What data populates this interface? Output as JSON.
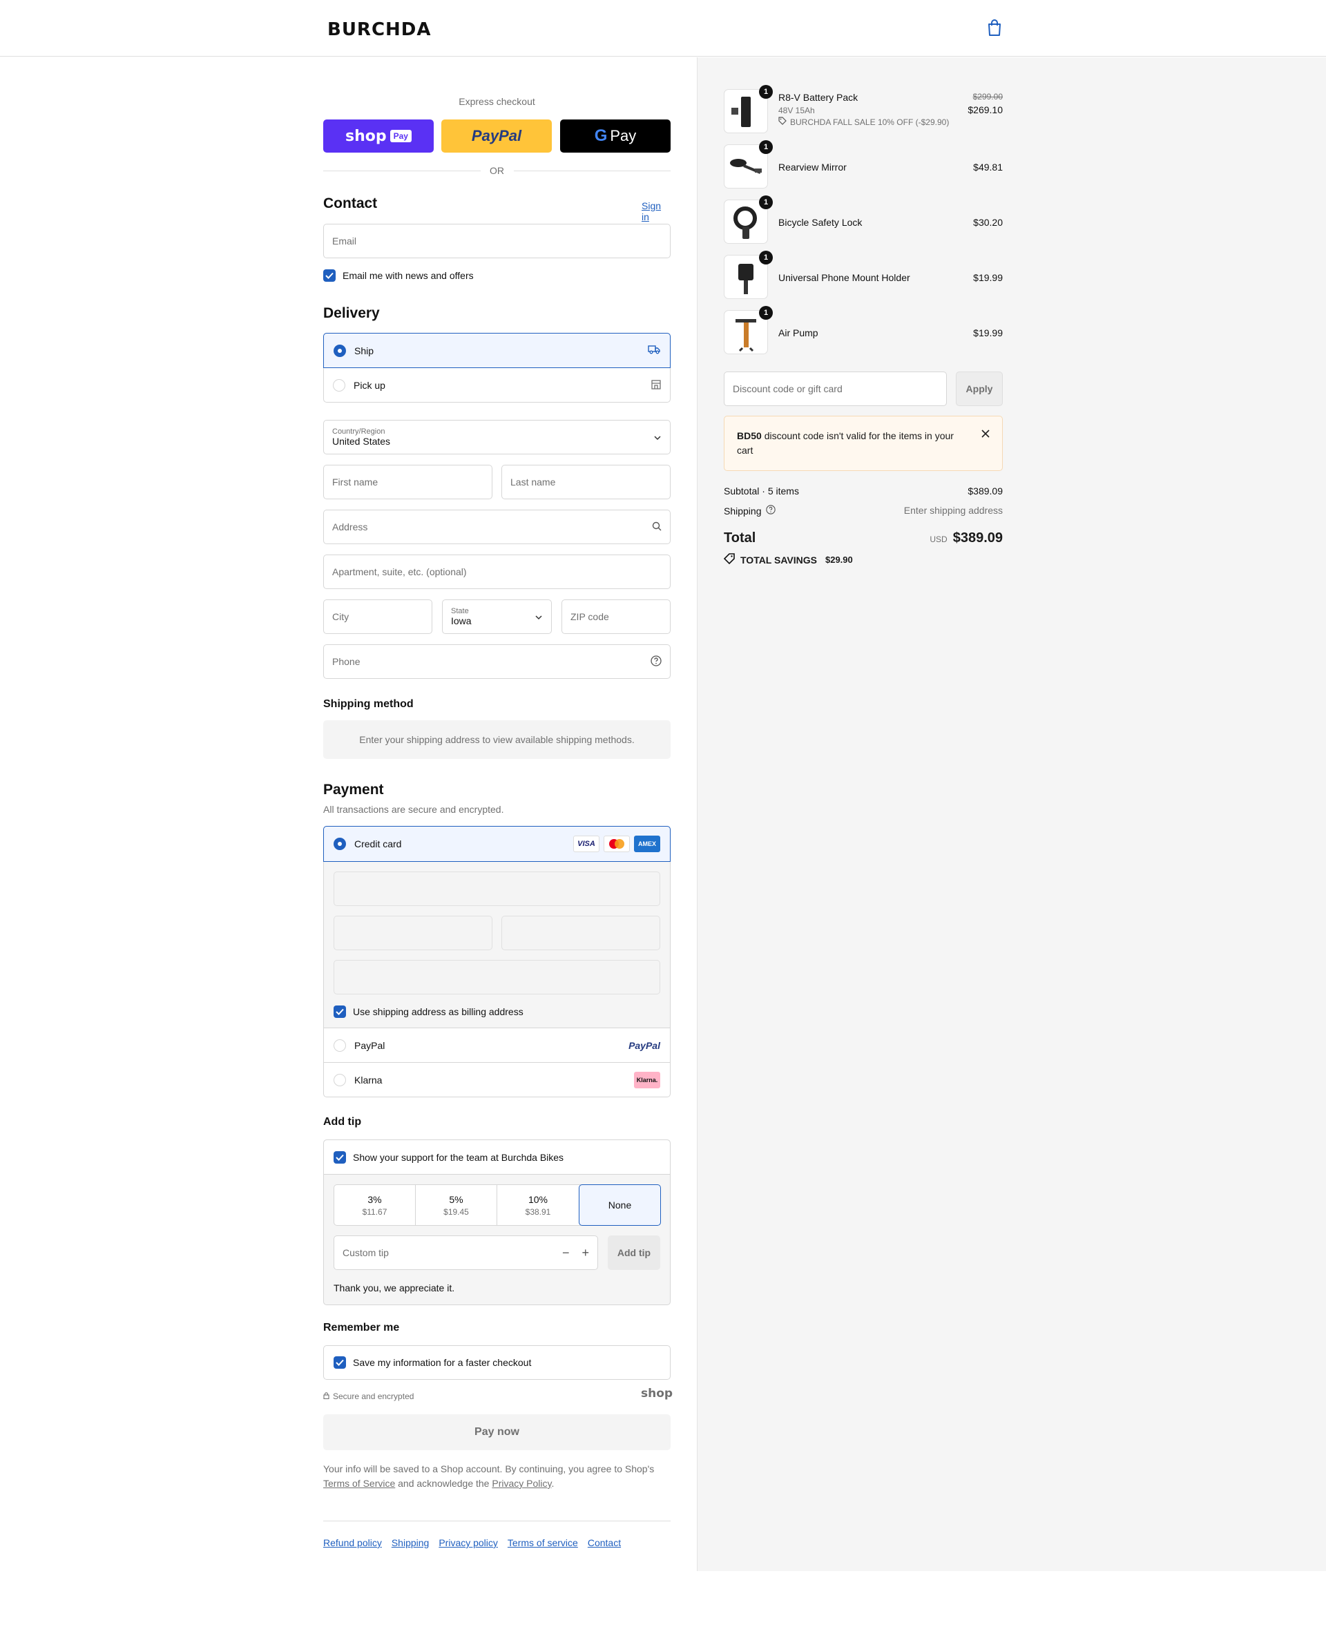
{
  "brand": {
    "logo_text": "BURCHDA"
  },
  "express": {
    "title": "Express checkout",
    "shop_pay_label": "shop",
    "shop_pay_badge": "Pay",
    "paypal_label": "PayPal",
    "gpay_label": "Pay",
    "or_label": "OR"
  },
  "contact": {
    "title": "Contact",
    "sign_in": "Sign in",
    "email_placeholder": "Email",
    "newsletter_label": "Email me with news and offers"
  },
  "delivery": {
    "title": "Delivery",
    "options": [
      {
        "label": "Ship",
        "selected": true
      },
      {
        "label": "Pick up",
        "selected": false
      }
    ],
    "country_label": "Country/Region",
    "country_value": "United States",
    "first_name_placeholder": "First name",
    "last_name_placeholder": "Last name",
    "address_placeholder": "Address",
    "apartment_placeholder": "Apartment, suite, etc. (optional)",
    "city_placeholder": "City",
    "state_label": "State",
    "state_value": "Iowa",
    "zip_placeholder": "ZIP code",
    "phone_placeholder": "Phone"
  },
  "shipping_method": {
    "title": "Shipping method",
    "notice": "Enter your shipping address to view available shipping methods."
  },
  "payment": {
    "title": "Payment",
    "subtitle": "All transactions are secure and encrypted.",
    "credit_card_label": "Credit card",
    "card_brands": [
      "VISA",
      "mastercard-icon",
      "AMEX"
    ],
    "billing_label": "Use shipping address as billing address",
    "paypal_label": "PayPal",
    "paypal_logo": "PayPal",
    "klarna_label": "Klarna",
    "klarna_logo": "Klarna."
  },
  "tip": {
    "title": "Add tip",
    "support_label": "Show your support for the team at Burchda Bikes",
    "options": [
      {
        "pct": "3%",
        "amount": "$11.67"
      },
      {
        "pct": "5%",
        "amount": "$19.45"
      },
      {
        "pct": "10%",
        "amount": "$38.91"
      },
      {
        "pct": "None",
        "amount": ""
      }
    ],
    "selected_index": 3,
    "custom_placeholder": "Custom tip",
    "add_button": "Add tip",
    "thanks": "Thank you, we appreciate it."
  },
  "remember": {
    "title": "Remember me",
    "save_label": "Save my information for a faster checkout",
    "secure_label": "Secure and encrypted",
    "shop_logo": "shop"
  },
  "pay_now": "Pay now",
  "legal": {
    "text_1": "Your info will be saved to a Shop account. By continuing, you agree to Shop's",
    "terms_link": "Terms of Service",
    "text_2": "and acknowledge the",
    "privacy_link": "Privacy Policy",
    "text_3": "."
  },
  "footer_links": [
    "Refund policy",
    "Shipping",
    "Privacy policy",
    "Terms of service",
    "Contact"
  ],
  "cart": {
    "items": [
      {
        "qty": "1",
        "name": "R8-V Battery Pack",
        "variant": "48V 15Ah",
        "original_price": "$299.00",
        "price": "$269.10",
        "discount": "BURCHDA FALL SALE 10% OFF (-$29.90)"
      },
      {
        "qty": "1",
        "name": "Rearview Mirror",
        "price": "$49.81"
      },
      {
        "qty": "1",
        "name": "Bicycle Safety Lock",
        "price": "$30.20"
      },
      {
        "qty": "1",
        "name": "Universal Phone Mount Holder",
        "price": "$19.99"
      },
      {
        "qty": "1",
        "name": "Air Pump",
        "price": "$19.99"
      }
    ],
    "discount_placeholder": "Discount code or gift card",
    "apply_label": "Apply",
    "alert_code": "BD50",
    "alert_text": "discount code isn't valid for the items in your cart",
    "subtotal_label": "Subtotal · 5 items",
    "subtotal_value": "$389.09",
    "shipping_label": "Shipping",
    "shipping_value": "Enter shipping address",
    "total_label": "Total",
    "currency": "USD",
    "total_value": "$389.09",
    "savings_label": "TOTAL SAVINGS",
    "savings_value": "$29.90"
  },
  "colors": {
    "accent": "#1f5fbf",
    "shop_pay": "#5a31f4",
    "paypal": "#ffc439",
    "alert_bg": "#fff8ef"
  }
}
